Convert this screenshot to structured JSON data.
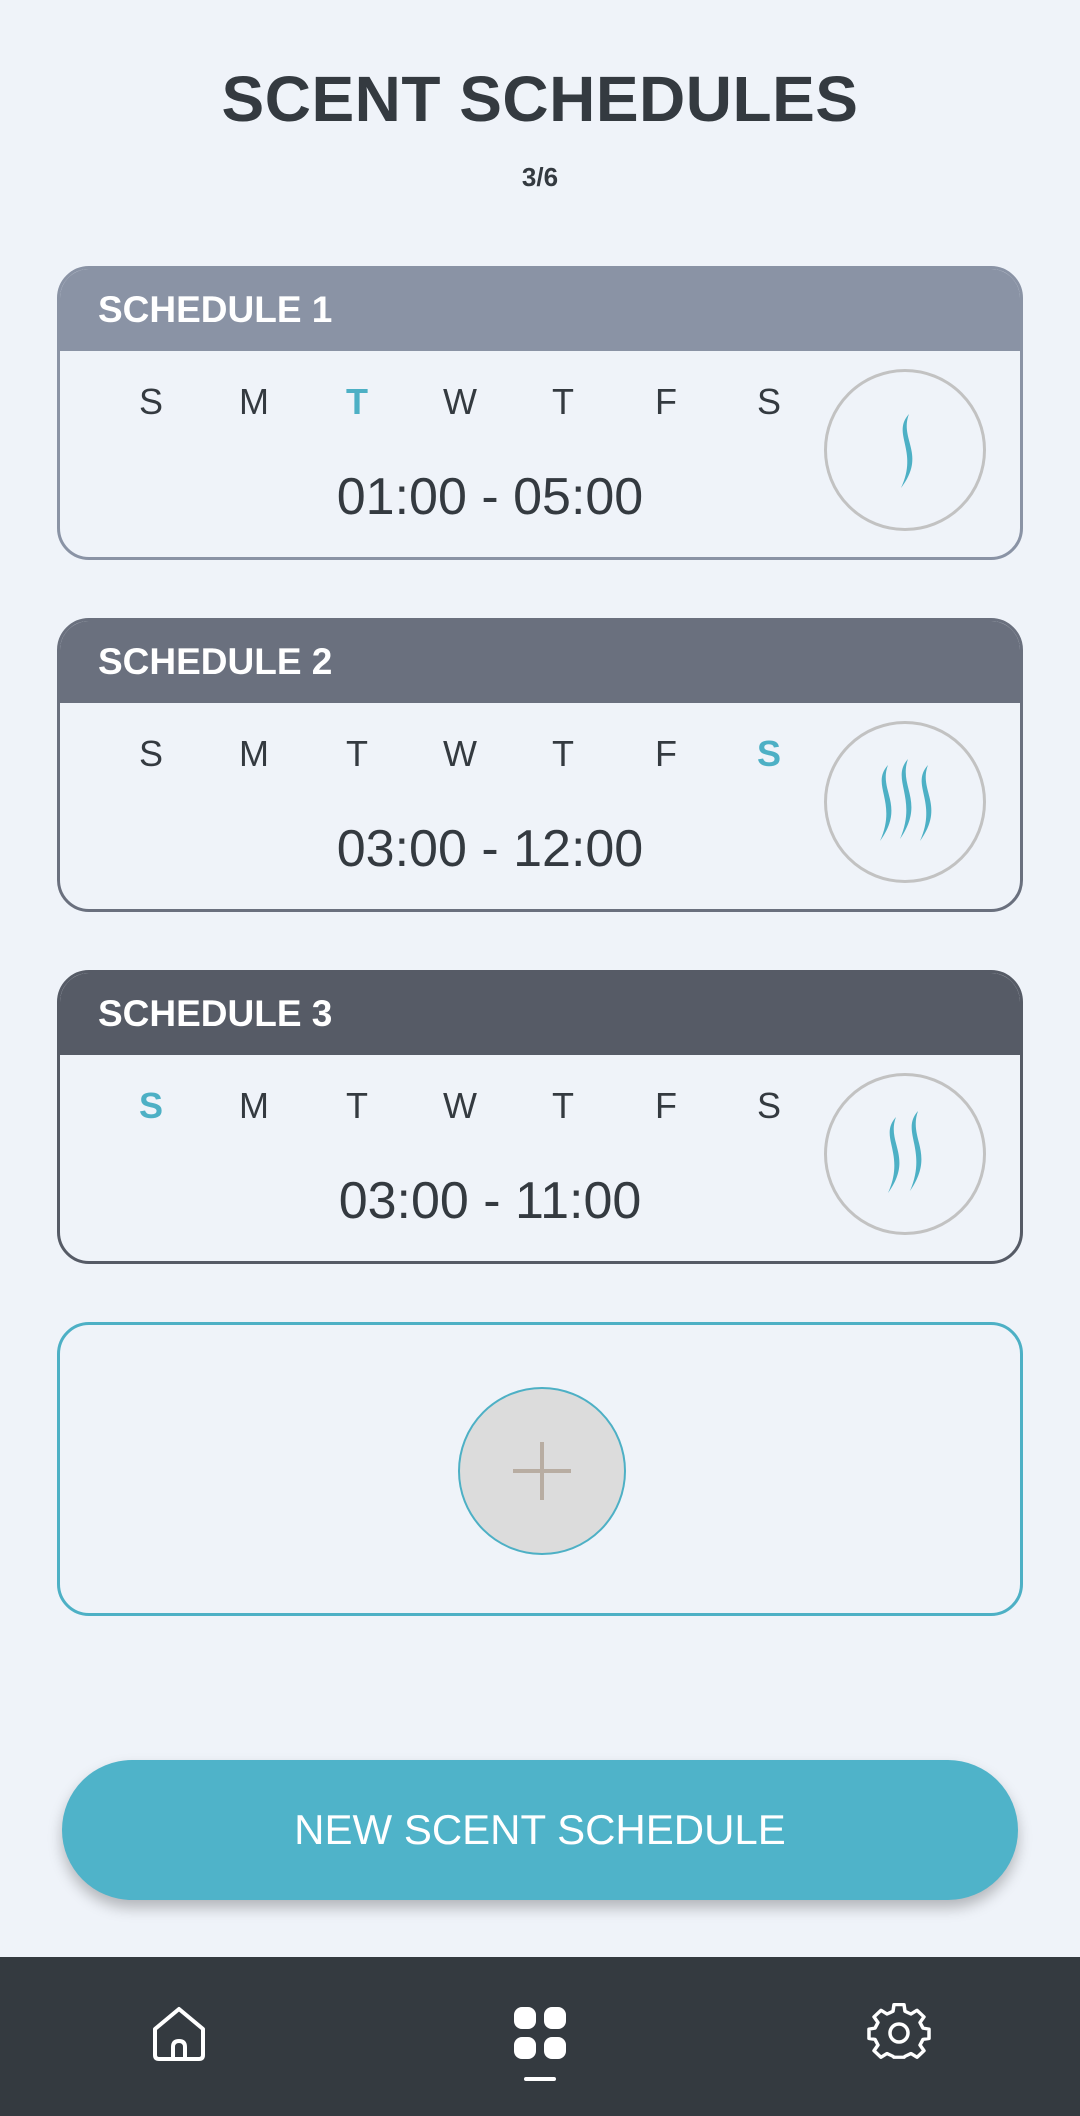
{
  "header": {
    "title": "SCENT SCHEDULES",
    "counter": "3/6"
  },
  "colors": {
    "accent": "#4db0c5",
    "card1_header": "#8a93a5",
    "card2_header": "#6a707e",
    "card3_header": "#565b66",
    "nav_bg": "#343a40"
  },
  "schedules": [
    {
      "name": "SCHEDULE 1",
      "days": [
        "S",
        "M",
        "T",
        "W",
        "T",
        "F",
        "S"
      ],
      "active_day_index": 2,
      "time": "01:00 - 05:00",
      "intensity": 1,
      "intensity_icon": "single-wave-icon"
    },
    {
      "name": "SCHEDULE 2",
      "days": [
        "S",
        "M",
        "T",
        "W",
        "T",
        "F",
        "S"
      ],
      "active_day_index": 6,
      "time": "03:00 - 12:00",
      "intensity": 3,
      "intensity_icon": "triple-wave-icon"
    },
    {
      "name": "SCHEDULE 3",
      "days": [
        "S",
        "M",
        "T",
        "W",
        "T",
        "F",
        "S"
      ],
      "active_day_index": 0,
      "time": "03:00 - 11:00",
      "intensity": 2,
      "intensity_icon": "double-wave-icon"
    }
  ],
  "add_schedule": {
    "icon": "plus-icon"
  },
  "actions": {
    "new_schedule_label": "NEW SCENT SCHEDULE"
  },
  "nav": {
    "items": [
      {
        "icon": "home-icon",
        "active": false
      },
      {
        "icon": "grid-icon",
        "active": true
      },
      {
        "icon": "gear-icon",
        "active": false
      }
    ]
  }
}
